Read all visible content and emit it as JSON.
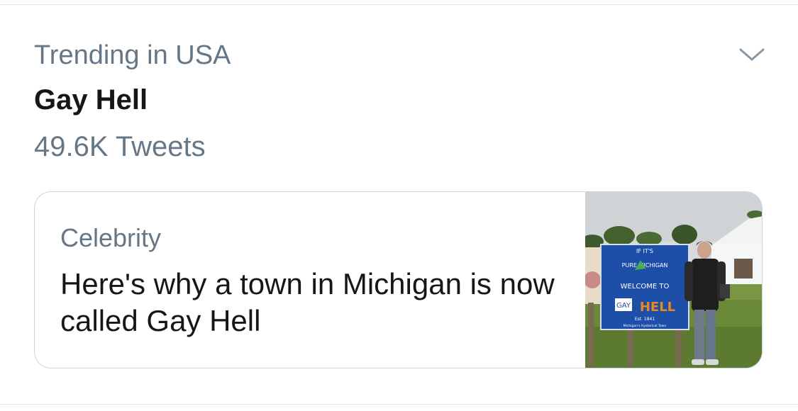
{
  "trend": {
    "context": "Trending in USA",
    "title": "Gay Hell",
    "tweet_count": "49.6K Tweets",
    "menu_icon": "chevron-down-icon"
  },
  "card": {
    "category": "Celebrity",
    "headline": "Here's why a town in Michigan is now called Gay Hell",
    "image": {
      "sign_line1": "IF IT'S",
      "sign_line2": "PURE MICHIGAN",
      "sign_line3": "WELCOME TO",
      "sign_line4_prefix": "",
      "sign_overlay": "GAY",
      "sign_hell": "HELL",
      "sign_est": "Est. 1841",
      "sign_tagline": "Michigan's Hysterical Town"
    }
  },
  "colors": {
    "primary_text": "#14171a",
    "secondary_text": "#657786",
    "border": "#ccd6dd",
    "sign_blue": "#1e4fa8",
    "hell_orange": "#e88a1c"
  }
}
